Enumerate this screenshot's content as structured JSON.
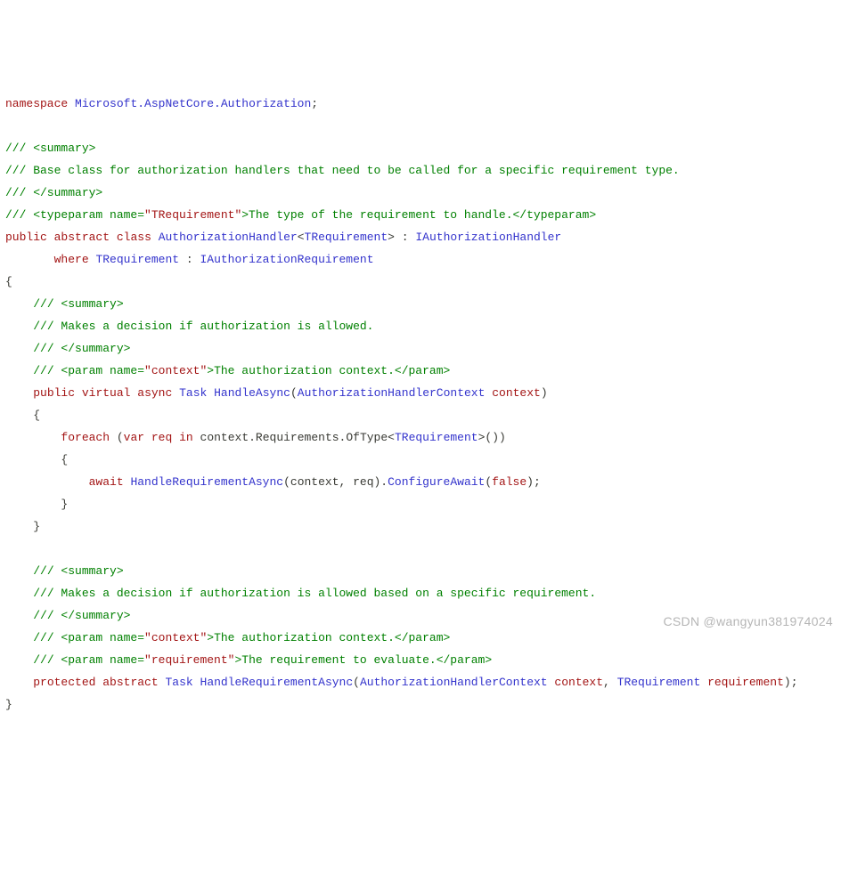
{
  "code": {
    "l01": {
      "kw": "namespace",
      "ns": "Microsoft.AspNetCore.Authorization",
      "semi": ";"
    },
    "l02": "",
    "l03": "/// <summary>",
    "l04": "/// Base class for authorization handlers that need to be called for a specific requirement type.",
    "l05": "/// </summary>",
    "l06a": "/// <typeparam name=",
    "l06b": "\"TRequirement\"",
    "l06c": ">The type of the requirement to handle.</typeparam>",
    "l07a": "public",
    "l07b": "abstract",
    "l07c": "class",
    "l07d": "AuthorizationHandler",
    "l07e": "<",
    "l07f": "TRequirement",
    "l07g": "> : ",
    "l07h": "IAuthorizationHandler",
    "l08a": "where",
    "l08b": "TRequirement",
    "l08c": " : ",
    "l08d": "IAuthorizationRequirement",
    "l09": "{",
    "l10": "/// <summary>",
    "l11": "/// Makes a decision if authorization is allowed.",
    "l12": "/// </summary>",
    "l13a": "/// <param name=",
    "l13b": "\"context\"",
    "l13c": ">The authorization context.</param>",
    "l14a": "public",
    "l14b": "virtual",
    "l14c": "async",
    "l14d": "Task",
    "l14e": "HandleAsync",
    "l14f": "(",
    "l14g": "AuthorizationHandlerContext",
    "l14h": "context",
    "l14i": ")",
    "l15": "{",
    "l16a": "foreach",
    "l16b": "(",
    "l16c": "var",
    "l16d": "req",
    "l16e": "in",
    "l16f": "context.Requirements.OfType",
    "l16g": "<",
    "l16h": "TRequirement",
    "l16i": ">())",
    "l17": "{",
    "l18a": "await",
    "l18b": "HandleRequirementAsync",
    "l18c": "(context, req).",
    "l18d": "ConfigureAwait",
    "l18e": "(",
    "l18f": "false",
    "l18g": ");",
    "l19": "}",
    "l20": "}",
    "l21": "",
    "l22": "/// <summary>",
    "l23": "/// Makes a decision if authorization is allowed based on a specific requirement.",
    "l24": "/// </summary>",
    "l25a": "/// <param name=",
    "l25b": "\"context\"",
    "l25c": ">The authorization context.</param>",
    "l26a": "/// <param name=",
    "l26b": "\"requirement\"",
    "l26c": ">The requirement to evaluate.</param>",
    "l27a": "protected",
    "l27b": "abstract",
    "l27c": "Task",
    "l27d": "HandleRequirementAsync",
    "l27e": "(",
    "l27f": "AuthorizationHandlerContext",
    "l27g": "context",
    "l27h": ", ",
    "l27i": "TRequirement",
    "l27j": "requirement",
    "l27k": ");",
    "l28": "}"
  },
  "watermark": "CSDN @wangyun381974024"
}
